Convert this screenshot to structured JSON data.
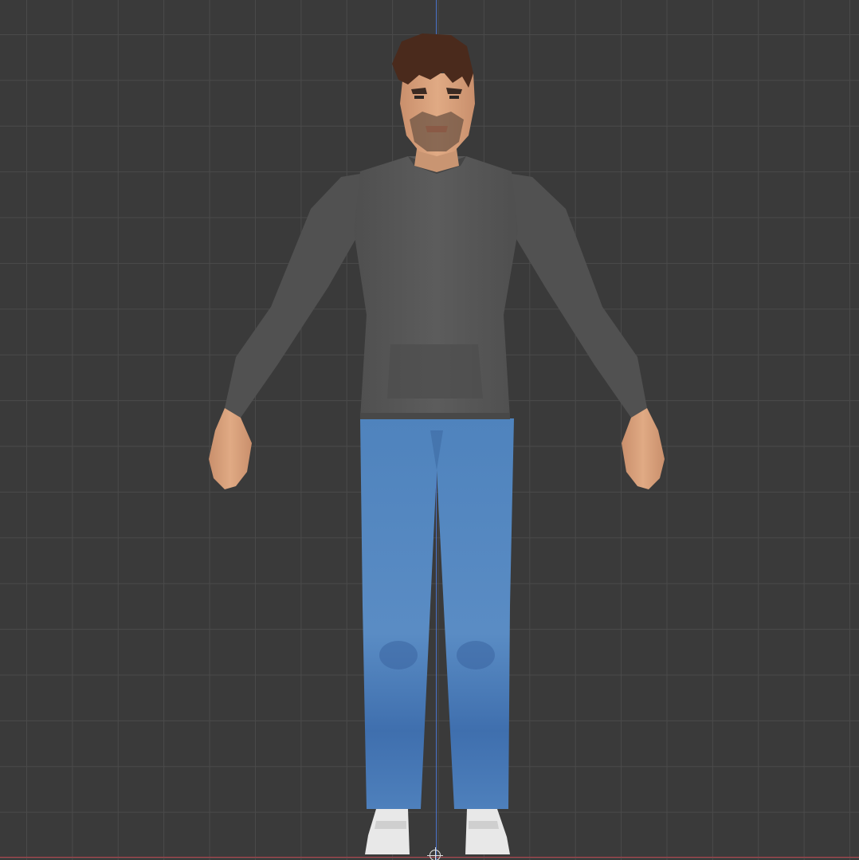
{
  "viewport": {
    "view": "front-orthographic",
    "grid": true,
    "colors": {
      "background": "#3a3a3a",
      "grid_line": "#4a4a4a",
      "z_axis": "#4a73c9",
      "x_axis": "#b2414b"
    }
  },
  "model": {
    "icon": "character-model-icon",
    "pose": "A-pose",
    "parts": {
      "hair_color": "#4a2a1c",
      "skin_color": "#d9a27d",
      "sweater_color": "#565656",
      "jeans_color": "#4e7fb8",
      "shoe_color": "#e6e6e6"
    }
  }
}
